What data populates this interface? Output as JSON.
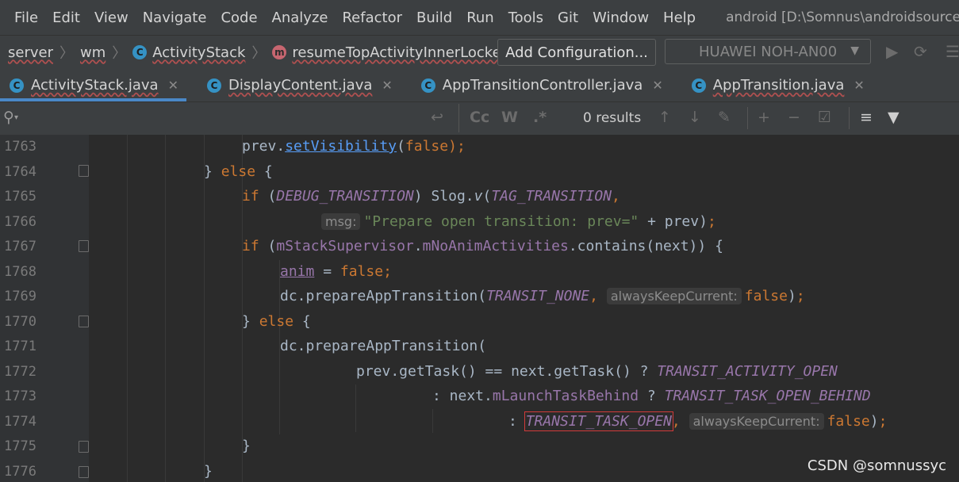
{
  "menu": {
    "items": [
      {
        "label": "File"
      },
      {
        "label": "Edit"
      },
      {
        "label": "View"
      },
      {
        "label": "Navigate"
      },
      {
        "label": "Code"
      },
      {
        "label": "Analyze"
      },
      {
        "label": "Refactor"
      },
      {
        "label": "Build"
      },
      {
        "label": "Run"
      },
      {
        "label": "Tools"
      },
      {
        "label": "Git"
      },
      {
        "label": "Window"
      },
      {
        "label": "Help"
      }
    ],
    "window_title": "android [D:\\Somnus\\androidsource"
  },
  "breadcrumb": {
    "items": [
      "server",
      "wm",
      "ActivityStack",
      "resumeTopActivityInnerLocked"
    ],
    "class_icon": "C",
    "method_icon": "m"
  },
  "toolbar": {
    "add_config": "Add Configuration...",
    "device": "HUAWEI NOH-AN00"
  },
  "tabs": [
    {
      "label": "ActivityStack.java",
      "icon": "C",
      "active": true
    },
    {
      "label": "DisplayContent.java",
      "icon": "C",
      "active": false
    },
    {
      "label": "AppTransitionController.java",
      "icon": "C",
      "active": false
    },
    {
      "label": "AppTransition.java",
      "icon": "C",
      "active": false
    }
  ],
  "find": {
    "results": "0 results",
    "match_case": "Cc",
    "words": "W",
    "regex": ".*"
  },
  "code": {
    "line_numbers": [
      "1763",
      "1764",
      "1765",
      "1766",
      "1767",
      "1768",
      "1769",
      "1770",
      "1771",
      "1772",
      "1773",
      "1774",
      "1775",
      "1776"
    ],
    "l1763": {
      "a": "prev.",
      "b": "setVisibility",
      "c": "(",
      "d": "false",
      "e": ");"
    },
    "l1764": {
      "a": "} ",
      "b": "else",
      "c": " {"
    },
    "l1765": {
      "a": "if",
      "b": " (",
      "c": "DEBUG_TRANSITION",
      "d": ") Slog.",
      "e": "v",
      "f": "(",
      "g": "TAG_TRANSITION",
      ",h": ","
    },
    "l1766": {
      "hint": "msg:",
      "str": "\"Prepare open transition: prev=\"",
      "rest": " + prev)",
      "semi": ";"
    },
    "l1767": {
      "a": "if",
      "b": " (",
      "c": "mStackSupervisor",
      ".": ".",
      "d": "mNoAnimActivities",
      "e": ".contains(next)) {"
    },
    "l1768": {
      "a": "anim",
      "b": " = ",
      "c": "false",
      "d": ";"
    },
    "l1769": {
      "a": "dc.prepareAppTransition(",
      "b": "TRANSIT_NONE",
      ",": ", ",
      "hint": "alwaysKeepCurrent:",
      "c": "false",
      "d": ");"
    },
    "l1770": {
      "a": "} ",
      "b": "else",
      "c": " {"
    },
    "l1771": {
      "a": "dc.prepareAppTransition("
    },
    "l1772": {
      "a": "prev.getTask() == next.getTask() ? ",
      "b": "TRANSIT_ACTIVITY_OPEN"
    },
    "l1773": {
      "a": ": next.",
      "b": "mLaunchTaskBehind",
      "c": " ? ",
      "d": "TRANSIT_TASK_OPEN_BEHIND"
    },
    "l1774": {
      "a": ": ",
      "b": "TRANSIT_TASK_OPEN",
      ",": ",",
      "hint": "alwaysKeepCurrent:",
      "c": "false",
      "d": ");"
    },
    "l1775": {
      "a": "}"
    },
    "l1776": {
      "a": "}"
    }
  },
  "watermark": "CSDN @somnussyc",
  "colors": {
    "keyword": "#cc7832",
    "field": "#9876aa",
    "string": "#6a8759",
    "link": "#589df6",
    "tab_accent": "#4a88c7",
    "highlight_box": "#d23a3a"
  }
}
